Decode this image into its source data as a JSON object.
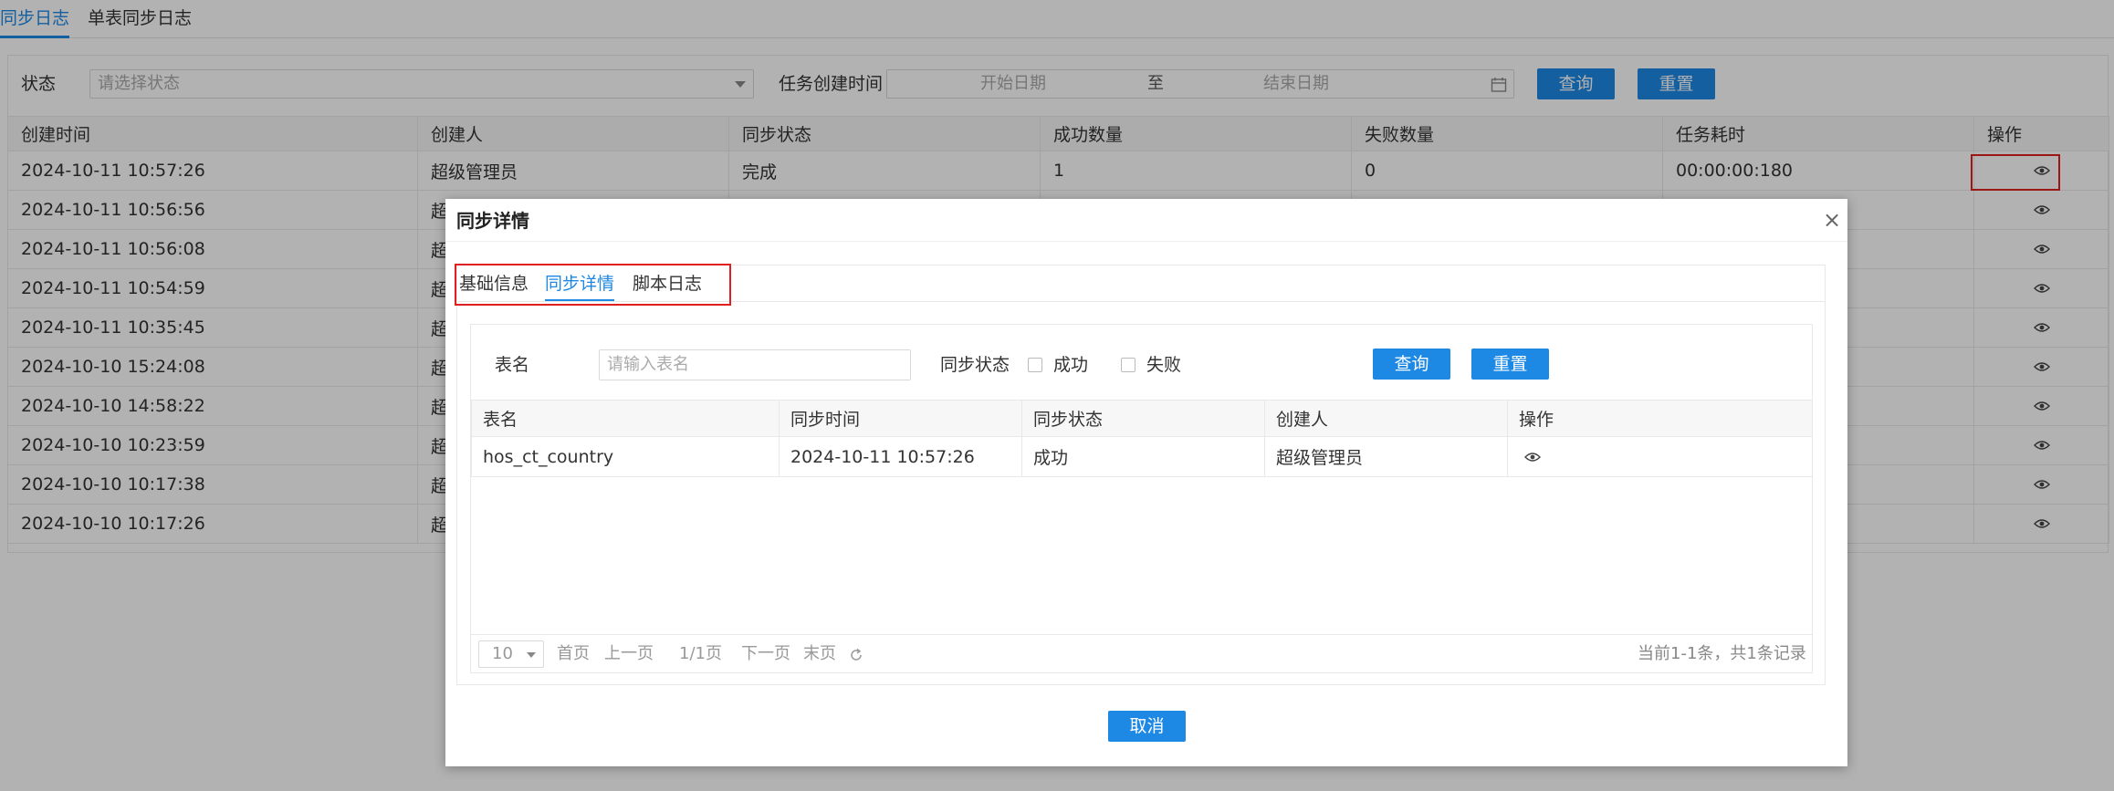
{
  "tabs": [
    "同步日志",
    "单表同步日志"
  ],
  "filters": {
    "status_label": "状态",
    "status_placeholder": "请选择状态",
    "created_label": "任务创建时间",
    "start_placeholder": "开始日期",
    "range_sep": "至",
    "end_placeholder": "结束日期",
    "query": "查询",
    "reset": "重置"
  },
  "log_table": {
    "headers": [
      "创建时间",
      "创建人",
      "同步状态",
      "成功数量",
      "失败数量",
      "任务耗时",
      "操作"
    ],
    "first_row": {
      "created": "2024-10-11 10:57:26",
      "creator": "超级管理员",
      "status": "完成",
      "success": "1",
      "fail": "0",
      "duration": "00:00:00:180"
    },
    "rows": [
      {
        "created": "2024-10-11 10:56:56",
        "creator": "超"
      },
      {
        "created": "2024-10-11 10:56:08",
        "creator": "超"
      },
      {
        "created": "2024-10-11 10:54:59",
        "creator": "超"
      },
      {
        "created": "2024-10-11 10:35:45",
        "creator": "超"
      },
      {
        "created": "2024-10-10 15:24:08",
        "creator": "超"
      },
      {
        "created": "2024-10-10 14:58:22",
        "creator": "超"
      },
      {
        "created": "2024-10-10 10:23:59",
        "creator": "超"
      },
      {
        "created": "2024-10-10 10:17:38",
        "creator": "超"
      },
      {
        "created": "2024-10-10 10:17:26",
        "creator": "超"
      }
    ]
  },
  "dialog": {
    "title": "同步详情",
    "close": "×",
    "tabs": [
      "基础信息",
      "同步详情",
      "脚本日志"
    ],
    "table_name_label": "表名",
    "table_name_placeholder": "请输入表名",
    "sync_status_label": "同步状态",
    "opt_success": "成功",
    "opt_fail": "失败",
    "query": "查询",
    "reset": "重置",
    "headers": [
      "表名",
      "同步时间",
      "同步状态",
      "创建人",
      "操作"
    ],
    "row": {
      "table": "hos_ct_country",
      "time": "2024-10-11 10:57:26",
      "status": "成功",
      "creator": "超级管理员"
    },
    "pager": {
      "page_size": "10",
      "first": "首页",
      "prev": "上一页",
      "page_info": "1/1页",
      "next": "下一页",
      "last": "末页",
      "summary": "当前1-1条，共1条记录"
    },
    "cancel": "取消"
  },
  "colors": {
    "accent": "#1e88e5",
    "highlight": "#e02020"
  }
}
